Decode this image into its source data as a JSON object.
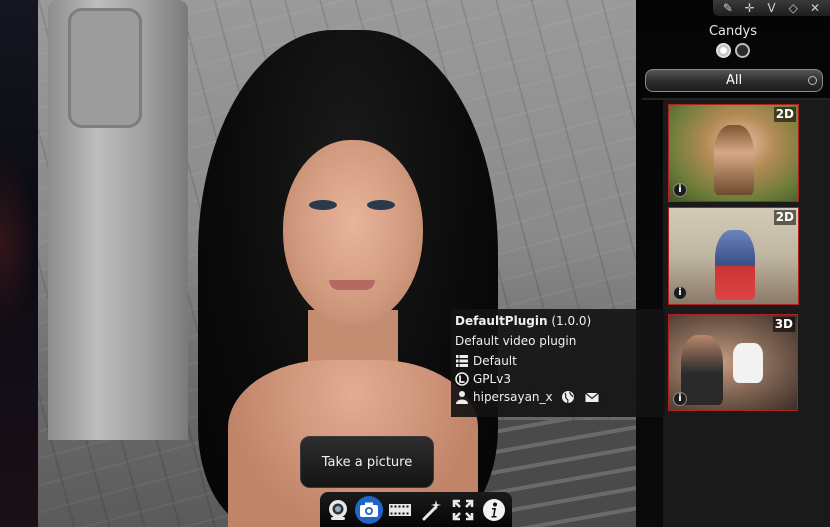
{
  "window": {
    "controls": [
      {
        "icon": "pencil-icon",
        "glyph": "✎"
      },
      {
        "icon": "move-icon",
        "glyph": "✛"
      },
      {
        "icon": "minimize-icon",
        "glyph": "V"
      },
      {
        "icon": "restore-icon",
        "glyph": "◇"
      },
      {
        "icon": "close-icon",
        "glyph": "✕"
      }
    ]
  },
  "panel": {
    "title": "Candys",
    "filter": "All",
    "thumbnails": [
      {
        "badge": "2D",
        "info": "i"
      },
      {
        "badge": "2D",
        "info": "i"
      },
      {
        "badge": "3D",
        "info": "i"
      }
    ]
  },
  "tooltip": {
    "name": "DefaultPlugin",
    "version": "(1.0.0)",
    "description": "Default video plugin",
    "category": "Default",
    "license": "GPLv3",
    "author": "hipersayan_x"
  },
  "hint": "Take a picture",
  "toolbar": {
    "buttons": [
      "webcam-icon",
      "camera-icon",
      "video-icon",
      "effects-wand-icon",
      "fullscreen-icon",
      "info-icon"
    ],
    "active": "camera-icon"
  },
  "colors": {
    "thumb_border": "#b32020",
    "active_button": "#1f64c8"
  }
}
